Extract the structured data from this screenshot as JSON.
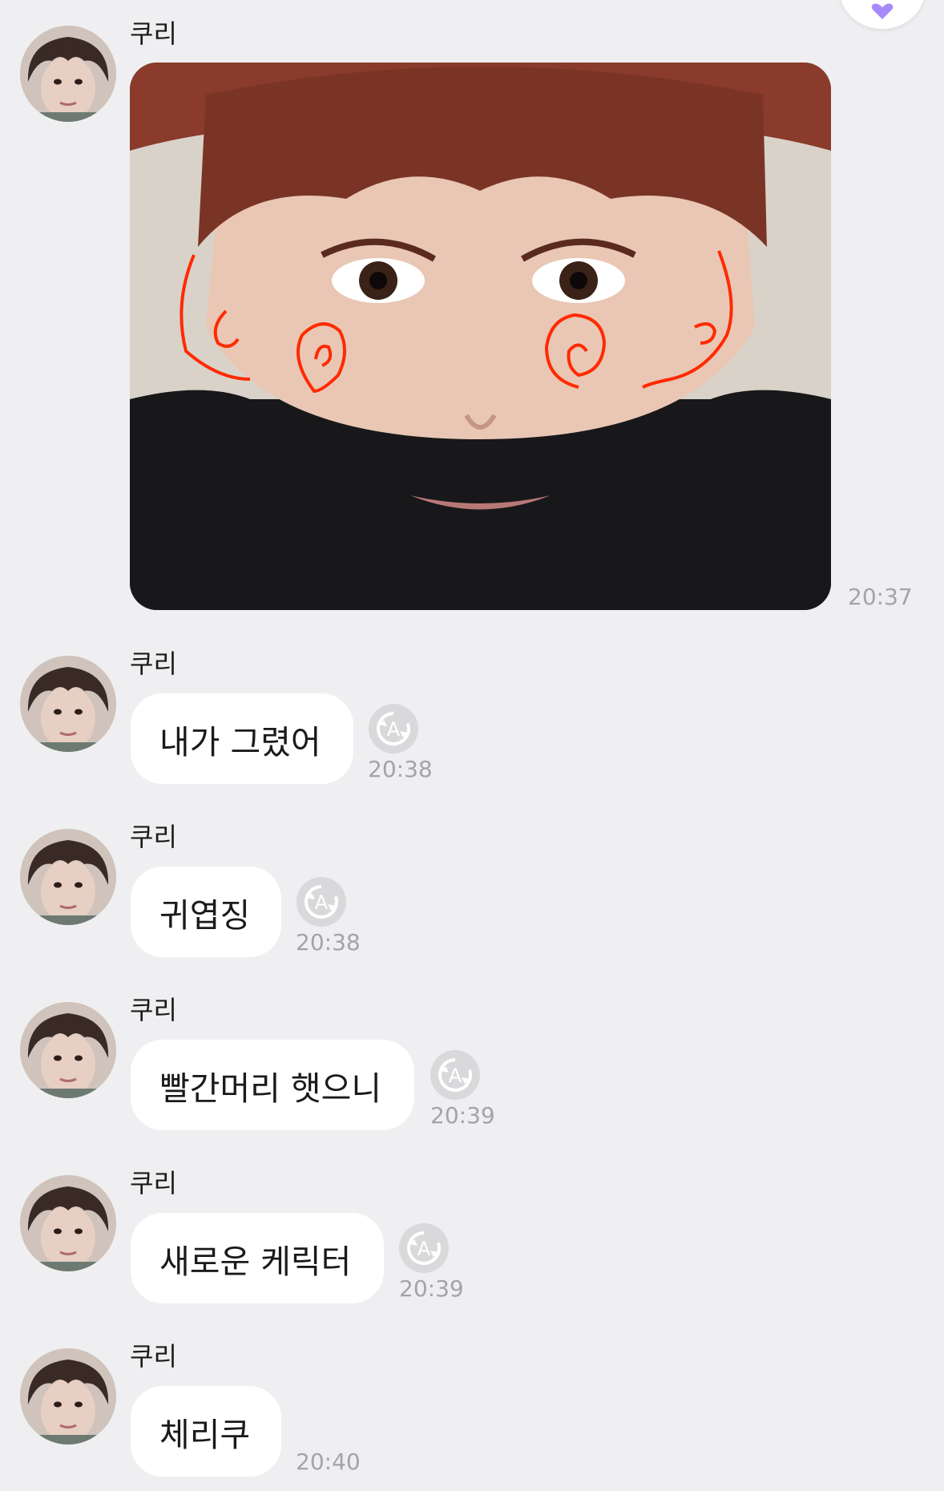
{
  "chat": {
    "sender_name": "쿠리",
    "photo_message": {
      "time": "20:37"
    },
    "messages": [
      {
        "text": "내가 그렸어",
        "time": "20:38",
        "auto_translate": true
      },
      {
        "text": "귀엽징",
        "time": "20:38",
        "auto_translate": true
      },
      {
        "text": "빨간머리 햇으니",
        "time": "20:39",
        "auto_translate": true
      },
      {
        "text": "새로운 케릭터",
        "time": "20:39",
        "auto_translate": true
      },
      {
        "text": "체리쿠",
        "time": "20:40",
        "auto_translate": false
      }
    ]
  },
  "icons": {
    "auto_translate": "auto-translate-icon",
    "top_button": "heart-icon"
  },
  "colors": {
    "background": "#efeff1",
    "bubble": "#ffffff",
    "time_text": "#a4a4a8",
    "accent": "#a78bfa",
    "drawing": "#ff2a00"
  }
}
